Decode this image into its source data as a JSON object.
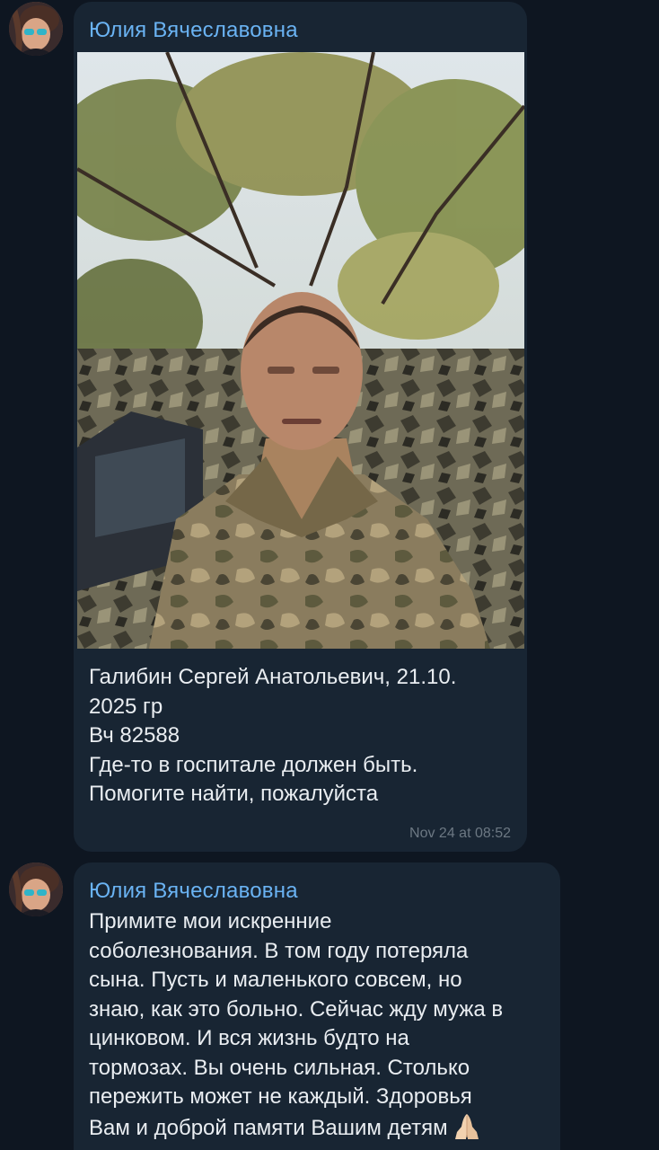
{
  "messages": [
    {
      "sender": "Юлия Вячеславовна",
      "caption_lines": [
        "Галибин Сергей Анатольевич, 21.10.",
        "2025 гр",
        "Вч 82588",
        "Где-то в госпитале должен быть.",
        "Помогите найти, пожалуйста"
      ],
      "time": "Nov 24 at 08:52",
      "has_photo": true
    },
    {
      "sender": "Юлия Вячеславовна",
      "text_lines": [
        "Примите мои искренние",
        "соболезнования. В том году потеряла",
        "сына. Пусть и маленького совсем, но",
        "знаю, как это больно. Сейчас жду мужа в",
        "цинковом. И вся жизнь будто на",
        "тормозах. Вы очень сильная. Столько",
        "пережить может не каждый. Здоровья",
        "Вам и доброй памяти Вашим детям"
      ],
      "emoji": "🙏"
    }
  ],
  "colors": {
    "background": "#0e1621",
    "bubble": "#182533",
    "sender_name": "#6ab3f3",
    "text": "#e9edf1",
    "timestamp": "#6c7883"
  }
}
